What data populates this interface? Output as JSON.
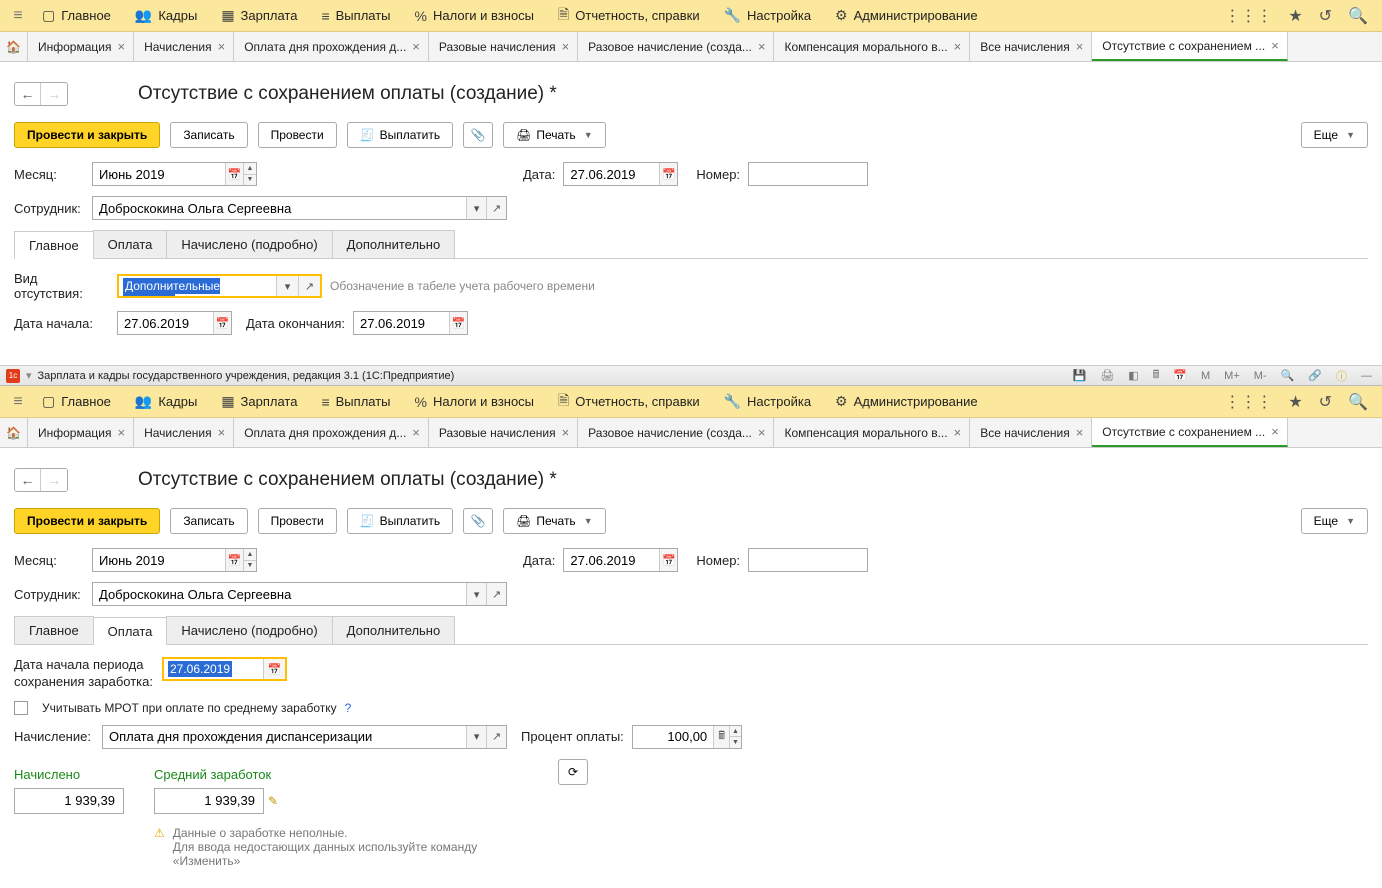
{
  "nav": {
    "items": [
      {
        "icon": "▭",
        "label": "Главное"
      },
      {
        "icon": "👥",
        "label": "Кадры"
      },
      {
        "icon": "▦",
        "label": "Зарплата"
      },
      {
        "icon": "≡",
        "label": "Выплаты"
      },
      {
        "icon": "%",
        "label": "Налоги и взносы"
      },
      {
        "icon": "🗎",
        "label": "Отчетность, справки"
      },
      {
        "icon": "🔧",
        "label": "Настройка"
      },
      {
        "icon": "⚙",
        "label": "Администрирование"
      }
    ]
  },
  "tabs": [
    "Информация",
    "Начисления",
    "Оплата дня прохождения д...",
    "Разовые начисления",
    "Разовое начисление (созда...",
    "Компенсация морального в...",
    "Все начисления",
    "Отсутствие с сохранением ..."
  ],
  "title": "Отсутствие с сохранением оплаты (создание) *",
  "toolbar": {
    "post_close": "Провести и закрыть",
    "write": "Записать",
    "post": "Провести",
    "pay": "Выплатить",
    "print": "Печать",
    "more": "Еще"
  },
  "form": {
    "month_lbl": "Месяц:",
    "month_val": "Июнь 2019",
    "date_lbl": "Дата:",
    "date_val": "27.06.2019",
    "number_lbl": "Номер:",
    "number_val": "",
    "employee_lbl": "Сотрудник:",
    "employee_val": "Доброскокина Ольга Сергеевна"
  },
  "inner_tabs": [
    "Главное",
    "Оплата",
    "Начислено (подробно)",
    "Дополнительно"
  ],
  "main_tab": {
    "type_lbl": "Вид отсутствия:",
    "type_val": "Дополнительные выходны",
    "type_hint": "Обозначение в табеле учета рабочего времени",
    "start_lbl": "Дата начала:",
    "start_val": "27.06.2019",
    "end_lbl": "Дата окончания:",
    "end_val": "27.06.2019"
  },
  "app_title": "Зарплата и кадры государственного учреждения, редакция 3.1  (1С:Предприятие)",
  "pay_tab": {
    "period_lbl": "Дата начала периода сохранения заработка:",
    "period_val": "27.06.2019",
    "mrot_lbl": "Учитывать МРОТ при оплате по среднему заработку",
    "accrual_lbl": "Начисление:",
    "accrual_val": "Оплата дня прохождения диспансеризации",
    "percent_lbl": "Процент оплаты:",
    "percent_val": "100,00",
    "accrued_lbl": "Начислено",
    "accrued_val": "1 939,39",
    "avg_lbl": "Средний заработок",
    "avg_val": "1 939,39",
    "warn1": "Данные о заработке неполные.",
    "warn2": "Для ввода недостающих данных используйте команду «Изменить»"
  }
}
